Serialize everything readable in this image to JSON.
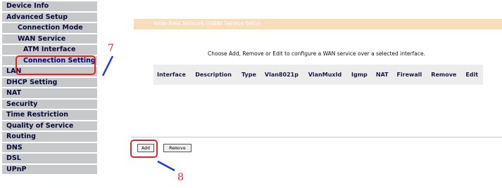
{
  "sidebar": {
    "items": [
      {
        "label": "Device Info"
      },
      {
        "label": "Advanced Setup"
      },
      {
        "label": "Connection Mode"
      },
      {
        "label": "WAN Service"
      },
      {
        "label": "ATM Interface"
      },
      {
        "label": "Connection Setting"
      },
      {
        "label": "LAN"
      },
      {
        "label": "DHCP Setting"
      },
      {
        "label": "NAT"
      },
      {
        "label": "Security"
      },
      {
        "label": "Time Restriction"
      },
      {
        "label": "Quality of Service"
      },
      {
        "label": "Routing"
      },
      {
        "label": "DNS"
      },
      {
        "label": "DSL"
      },
      {
        "label": "UPnP"
      }
    ]
  },
  "main": {
    "title": "Wide Area Network (WAN) Service Setup",
    "instruction": "Choose Add, Remove or Edit to configure a WAN service over a selected interface.",
    "table": {
      "headers": [
        "Interface",
        "Description",
        "Type",
        "Vlan8021p",
        "VlanMuxId",
        "Igmp",
        "NAT",
        "Firewall",
        "Remove",
        "Edit"
      ]
    },
    "buttons": {
      "add": "Add",
      "remove": "Remove"
    }
  },
  "annotations": {
    "step7": "7",
    "step8": "8",
    "color": "#e32424"
  }
}
